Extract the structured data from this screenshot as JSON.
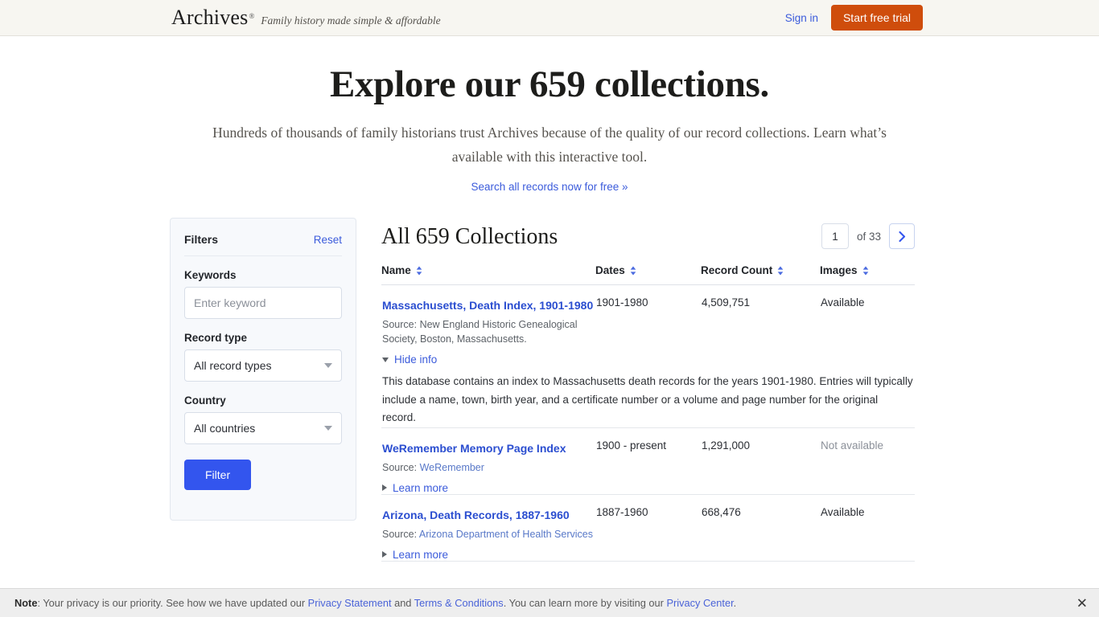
{
  "header": {
    "brand": "Archives",
    "brand_mark": "®",
    "tagline": "Family history made simple & affordable",
    "signin_label": "Sign in",
    "trial_label": "Start free trial"
  },
  "hero": {
    "title": "Explore our 659 collections.",
    "subtitle": "Hundreds of thousands of family historians trust Archives because of the quality of our record collections. Learn what’s available with this interactive tool.",
    "cta_label": "Search all records now for free »"
  },
  "filters": {
    "title": "Filters",
    "reset_label": "Reset",
    "keywords_label": "Keywords",
    "keywords_value": "",
    "keywords_placeholder": "Enter keyword",
    "record_type_label": "Record type",
    "record_type_value": "All record types",
    "country_label": "Country",
    "country_value": "All countries",
    "submit_label": "Filter"
  },
  "results": {
    "heading": "All 659 Collections",
    "page_value": "1",
    "page_total_label": "of 33",
    "columns": [
      {
        "label": "Name",
        "sortable": true
      },
      {
        "label": "Dates",
        "sortable": true
      },
      {
        "label": "Record Count",
        "sortable": true
      },
      {
        "label": "Images",
        "sortable": true
      }
    ],
    "source_prefix": "Source:",
    "hide_info_label": "Hide info",
    "learn_more_label": "Learn more",
    "rows": [
      {
        "name": "Massachusetts, Death Index, 1901-1980",
        "source_text": "New England Historic Genealogical Society, Boston, Massachusetts.",
        "source_is_link": false,
        "dates": "1901-1980",
        "record_count": "4,509,751",
        "images": "Available",
        "images_dim": false,
        "expanded": true,
        "toggle_label": "Hide info",
        "description": "This database contains an index to Massachusetts death records for the years 1901-1980. Entries will typically include a name, town, birth year, and a certificate number or a volume and page number for the original record."
      },
      {
        "name": "WeRemember Memory Page Index",
        "source_text": "WeRemember",
        "source_is_link": true,
        "dates": "1900 - present",
        "record_count": "1,291,000",
        "images": "Not available",
        "images_dim": true,
        "expanded": false,
        "toggle_label": "Learn more",
        "description": ""
      },
      {
        "name": "Arizona, Death Records, 1887-1960",
        "source_text": "Arizona Department of Health Services",
        "source_is_link": true,
        "dates": "1887-1960",
        "record_count": "668,476",
        "images": "Available",
        "images_dim": false,
        "expanded": false,
        "toggle_label": "Learn more",
        "description": ""
      }
    ]
  },
  "privacy": {
    "note_label": "Note",
    "text_1": ": Your privacy is our priority. See how we have updated our ",
    "link_1": "Privacy Statement",
    "text_2": " and ",
    "link_2": "Terms & Conditions",
    "text_3": ". You can learn more by visiting our ",
    "link_3": "Privacy Center",
    "text_4": ".",
    "close_label": "✕"
  },
  "colors": {
    "accent_orange": "#cf4d0c",
    "accent_blue": "#3355ee",
    "link_blue": "#3b5bdb",
    "header_bg": "#f7f6f1"
  }
}
